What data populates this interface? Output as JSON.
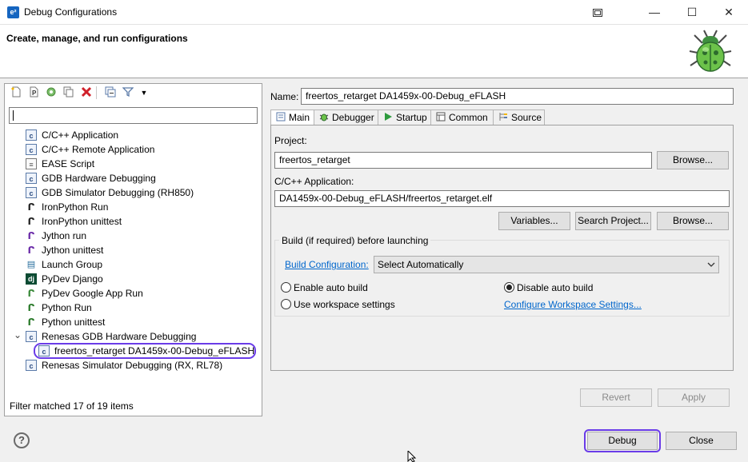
{
  "window": {
    "app_icon": "e²",
    "title": "Debug Configurations",
    "restore_icon": "restore-icon",
    "min_glyph": "—",
    "max_glyph": "☐",
    "close_glyph": "✕"
  },
  "header": {
    "title": "Create, manage, and run configurations"
  },
  "left": {
    "filter_value": "",
    "tree": [
      {
        "label": "C/C++ Application",
        "icon": "c-app-icon"
      },
      {
        "label": "C/C++ Remote Application",
        "icon": "c-app-icon"
      },
      {
        "label": "EASE Script",
        "icon": "ease-script-icon"
      },
      {
        "label": "GDB Hardware Debugging",
        "icon": "c-app-icon"
      },
      {
        "label": "GDB Simulator Debugging (RH850)",
        "icon": "c-app-icon"
      },
      {
        "label": "IronPython Run",
        "icon": "ironpython-icon"
      },
      {
        "label": "IronPython unittest",
        "icon": "ironpython-unittest-icon"
      },
      {
        "label": "Jython run",
        "icon": "jython-icon"
      },
      {
        "label": "Jython unittest",
        "icon": "jython-unittest-icon"
      },
      {
        "label": "Launch Group",
        "icon": "launch-group-icon"
      },
      {
        "label": "PyDev Django",
        "icon": "django-icon"
      },
      {
        "label": "PyDev Google App Run",
        "icon": "google-app-icon"
      },
      {
        "label": "Python Run",
        "icon": "python-icon"
      },
      {
        "label": "Python unittest",
        "icon": "python-unittest-icon"
      },
      {
        "label": "Renesas GDB Hardware Debugging",
        "icon": "c-app-icon"
      },
      {
        "label": "freertos_retarget DA1459x-00-Debug_eFLASH",
        "icon": "c-app-icon"
      },
      {
        "label": "Renesas Simulator Debugging (RX, RL78)",
        "icon": "c-app-icon"
      }
    ],
    "expand_glyph": "⌄",
    "filter_status": "Filter matched 17 of 19 items"
  },
  "right": {
    "name_label": "Name:",
    "name_value": "freertos_retarget DA1459x-00-Debug_eFLASH",
    "tabs": [
      {
        "label": "Main",
        "icon": "main-tab-icon"
      },
      {
        "label": "Debugger",
        "icon": "debugger-tab-icon"
      },
      {
        "label": "Startup",
        "icon": "startup-tab-icon"
      },
      {
        "label": "Common",
        "icon": "common-tab-icon"
      },
      {
        "label": "Source",
        "icon": "source-tab-icon"
      }
    ],
    "project_label": "Project:",
    "project_value": "freertos_retarget",
    "browse_label": "Browse...",
    "app_label": "C/C++ Application:",
    "app_value": "DA1459x-00-Debug_eFLASH/freertos_retarget.elf",
    "variables_label": "Variables...",
    "search_project_label": "Search Project...",
    "build_title": "Build (if required) before launching",
    "build_config_link": "Build Configuration:",
    "build_config_value": "Select Automatically",
    "enable_auto_build": "Enable auto build",
    "disable_auto_build": "Disable auto build",
    "use_workspace": "Use workspace settings",
    "configure_workspace_link": "Configure Workspace Settings...",
    "revert_label": "Revert",
    "apply_label": "Apply"
  },
  "bottom": {
    "help_glyph": "?",
    "debug_label": "Debug",
    "close_label": "Close"
  }
}
